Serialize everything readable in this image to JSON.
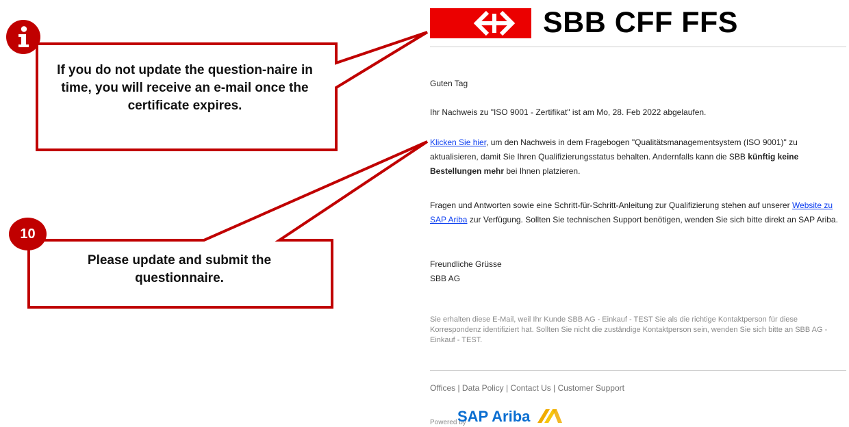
{
  "brand": {
    "logo_text": "SBB CFF FFS",
    "logo_color": "#eb0000"
  },
  "email": {
    "greeting": "Guten Tag",
    "expired_line": "Ihr Nachweis zu \"ISO 9001 - Zertifikat\" ist am Mo, 28. Feb 2022 abgelaufen.",
    "para1": {
      "link": "Klicken Sie hier",
      "text_a": ", um den Nachweis in dem Fragebogen \"Qualitätsmanagementsystem (ISO 9001)\" zu aktualisieren, damit Sie Ihren Qualifizierungsstatus behalten. Andernfalls kann die SBB ",
      "bold": "künftig keine Bestellungen mehr",
      "text_b": " bei Ihnen platzieren."
    },
    "para2": {
      "text_a": "Fragen und Antworten sowie eine Schritt-für-Schritt-Anleitung zur Qualifizierung stehen auf unserer ",
      "link": "Website zu SAP Ariba",
      "text_b": " zur Verfügung. Sollten Sie technischen Support benötigen, wenden Sie sich bitte direkt an SAP Ariba."
    },
    "closing": "Freundliche Grüsse",
    "signature": "SBB AG",
    "disclaimer": "Sie erhalten diese E-Mail, weil Ihr Kunde SBB AG - Einkauf - TEST Sie als die richtige Kontaktperson für diese Korrespondenz identifiziert hat. Sollten Sie nicht die zuständige Kontaktperson sein, wenden Sie sich bitte an SBB AG - Einkauf - TEST.",
    "footer_links": [
      "Offices",
      "Data Policy",
      "Contact Us",
      "Customer Support"
    ],
    "footer_separator": " | ",
    "powered_by": "Powered by",
    "sap_logo": "SAP Ariba"
  },
  "callouts": {
    "info": {
      "badge_icon": "info-icon",
      "text": "If you do not update the question-naire in time, you will receive an e-mail once the certificate expires."
    },
    "step": {
      "badge": "10",
      "text": "Please update and submit the questionnaire."
    }
  },
  "colors": {
    "callout_border": "#c00000",
    "link": "#0b3df0"
  }
}
